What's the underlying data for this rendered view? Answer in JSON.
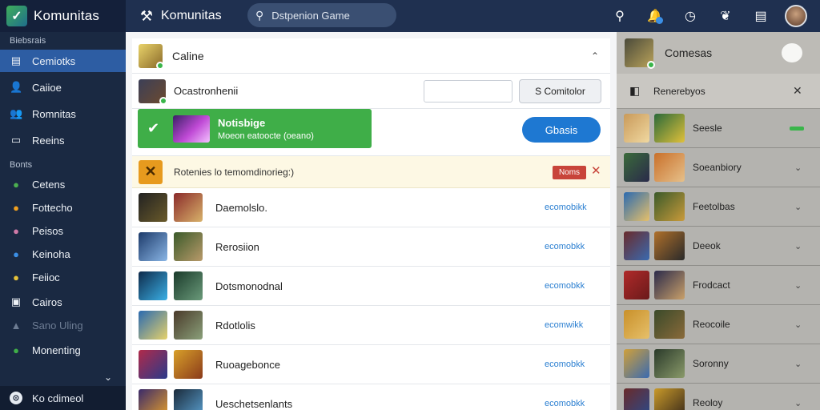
{
  "brand": {
    "name": "Komunitas"
  },
  "app": {
    "title": "Komunitas"
  },
  "search": {
    "placeholder": "Dstpenion Game"
  },
  "sidebar": {
    "section1": "Biebsrais",
    "items_top": [
      {
        "label": "Cemiotks",
        "icon": "id-card-icon",
        "glyph": "▤",
        "active": true
      },
      {
        "label": "Caiioe",
        "icon": "user-icon",
        "glyph": "👤",
        "active": false
      },
      {
        "label": "Romnitas",
        "icon": "group-icon",
        "glyph": "👥",
        "active": false
      },
      {
        "label": "Reeins",
        "icon": "monitor-icon",
        "glyph": "▭",
        "active": false
      }
    ],
    "section2": "Bonts",
    "items_bottom": [
      {
        "label": "Cetens",
        "icon": "game-icon-green",
        "glyph": "●",
        "color": "#4caf50"
      },
      {
        "label": "Fottecho",
        "icon": "game-icon-orange",
        "glyph": "●",
        "color": "#f0a020"
      },
      {
        "label": "Peisos",
        "icon": "game-icon-pink",
        "glyph": "●",
        "color": "#d07aa8"
      },
      {
        "label": "Keinoha",
        "icon": "game-icon-blue",
        "glyph": "●",
        "color": "#3b8fe6"
      },
      {
        "label": "Feiioc",
        "icon": "game-icon-yellow",
        "glyph": "●",
        "color": "#e6c23a"
      },
      {
        "label": "Cairos",
        "icon": "image-icon",
        "glyph": "▣",
        "color": "#eef2f7"
      },
      {
        "label": "Sano Uling",
        "icon": "upload-icon",
        "glyph": "▲",
        "color": "#6d7c93",
        "dim": true
      },
      {
        "label": "Monenting",
        "icon": "chat-icon",
        "glyph": "●",
        "color": "#3fae48"
      }
    ],
    "footer": "Ko cdimeol"
  },
  "main": {
    "header_title": "Caline",
    "row1": {
      "name": "Ocastronhenii",
      "button": "S Comitolor"
    },
    "banner": {
      "title": "Notisbige",
      "subtitle": "Moeon eatoocte (oeano)",
      "cta": "Gbasis"
    },
    "notice": {
      "text": "Rotenies lo temomdinorieg:)",
      "tag": "Noms"
    },
    "games": [
      {
        "name": "Daemolslo.",
        "link": "ecomobikk"
      },
      {
        "name": "Rerosiion",
        "link": "ecomobkk"
      },
      {
        "name": "Dotsmonodnal",
        "link": "ecomobkk"
      },
      {
        "name": "Rdotlolis",
        "link": "ecomwikk"
      },
      {
        "name": "Ruoagebonce",
        "link": "ecomobkk"
      },
      {
        "name": "Ueschetsenlants",
        "link": "ecomobkk"
      }
    ]
  },
  "right": {
    "title": "Comesas",
    "subheader": "Renerebyos",
    "items": [
      {
        "name": "Seesle"
      },
      {
        "name": "Soeanbiory"
      },
      {
        "name": "Feetolbas"
      },
      {
        "name": "Deeok"
      },
      {
        "name": "Frodcact"
      },
      {
        "name": "Reocoile"
      },
      {
        "name": "Soronny"
      },
      {
        "name": "Reoloy"
      }
    ]
  },
  "colors": {
    "topbar": "#1f3050",
    "sidebar": "#1a2942",
    "active": "#2d5da3",
    "banner": "#3fae48",
    "cta": "#1e78d2",
    "link": "#2b7fd1"
  }
}
